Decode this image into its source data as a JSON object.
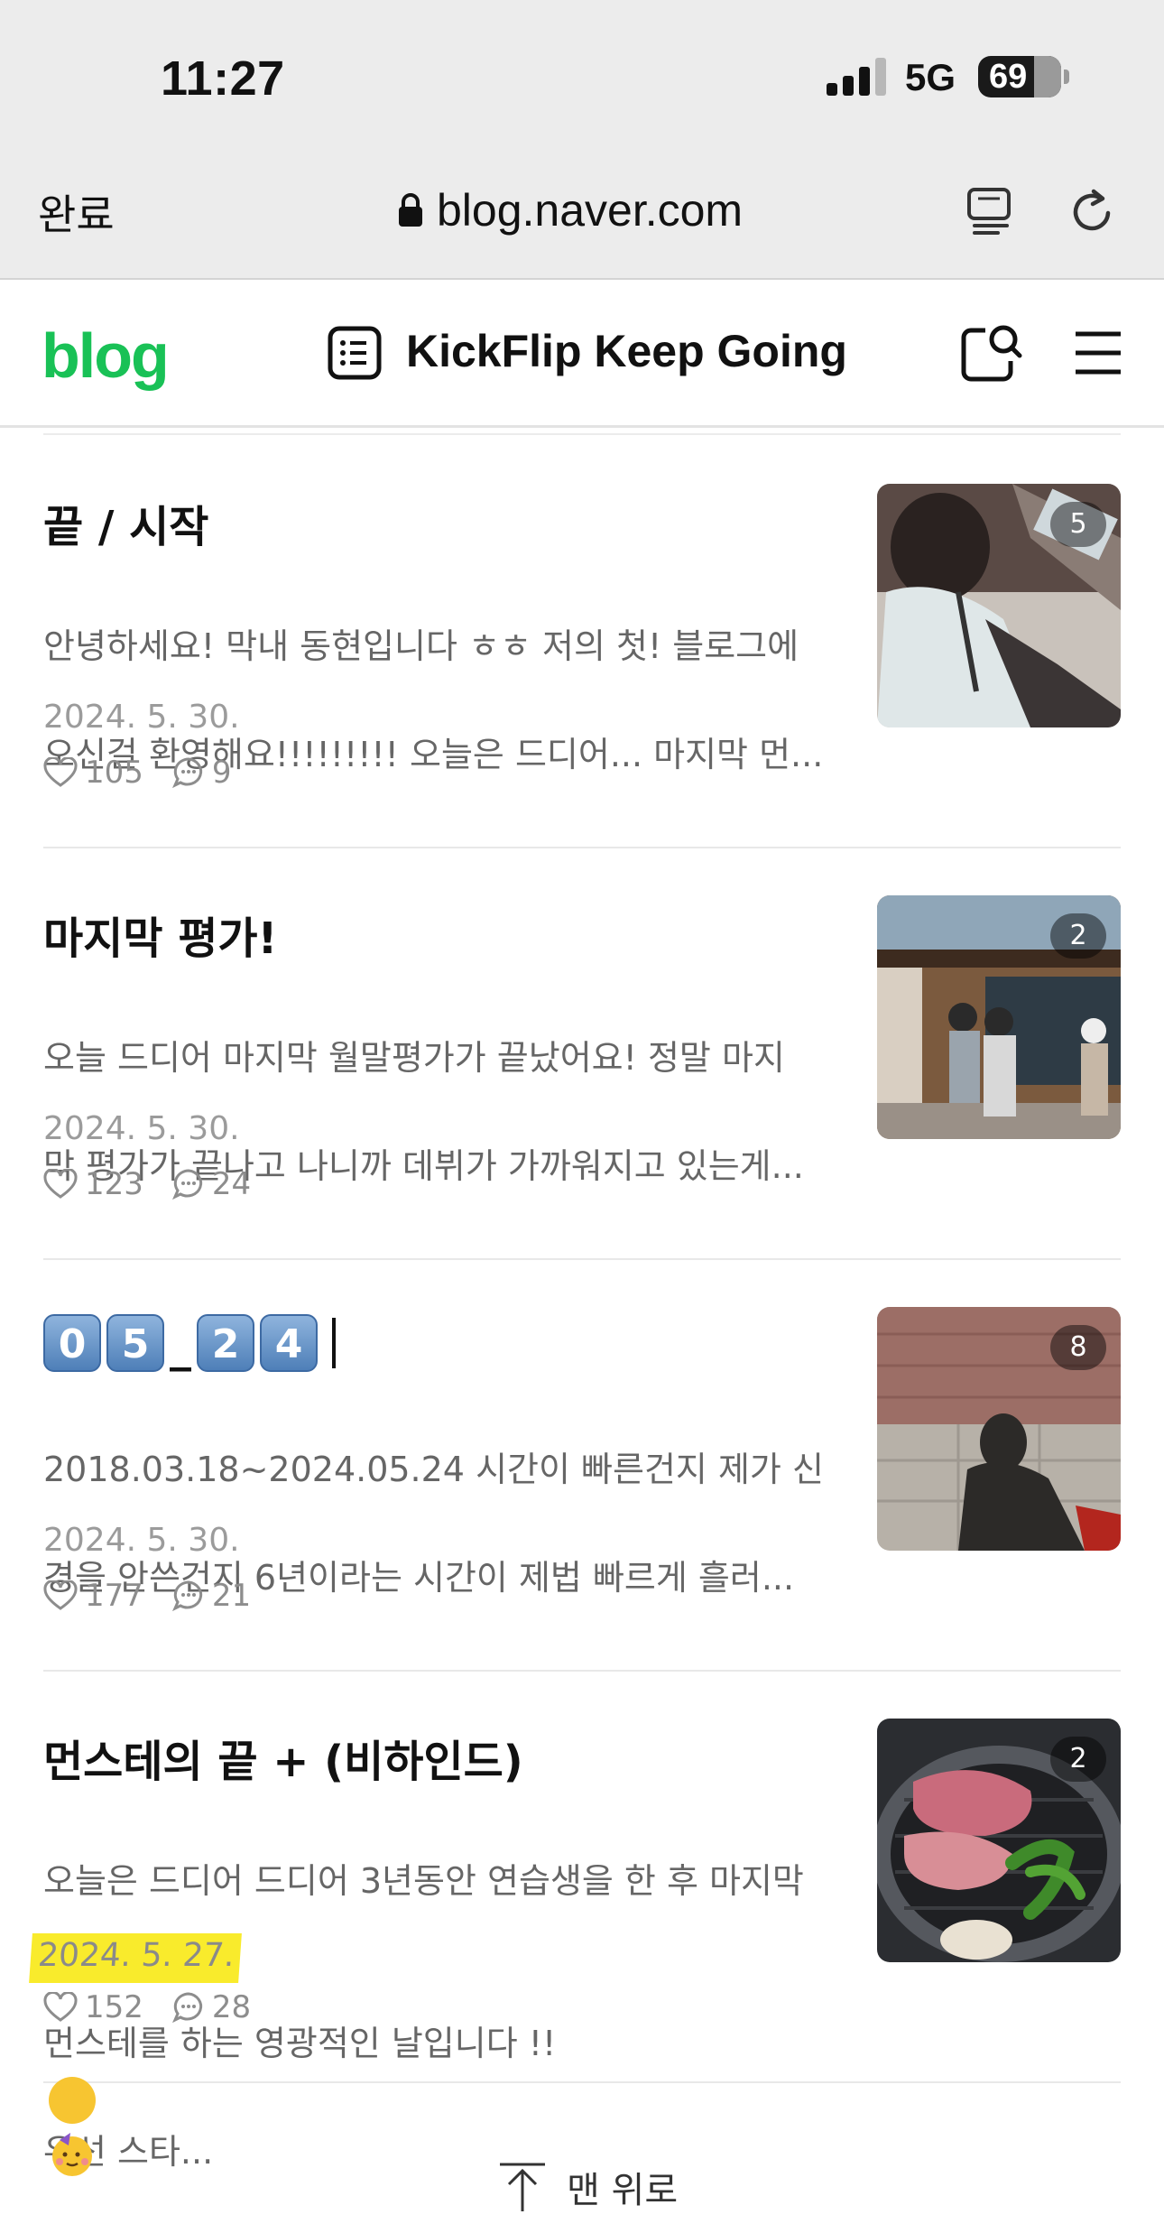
{
  "status_bar": {
    "time": "11:27",
    "network": "5G",
    "battery": "69"
  },
  "browser": {
    "done_label": "완료",
    "url": "blog.naver.com",
    "icons": [
      "lock-icon",
      "reader-icon",
      "reload-icon"
    ]
  },
  "blog_header": {
    "logo": "blog",
    "title": "KickFlip Keep Going",
    "logo_color": "#19c156"
  },
  "posts": [
    {
      "title": "끝 / 시작",
      "excerpt_line1": "안녕하세요! 막내 동현입니다 ㅎㅎ 저의 첫! 블로그에",
      "excerpt_line2": "오신걸 환영해요!!!!!!!!! 오늘은 드디어... 마지막 먼...",
      "date": "2024. 5. 30.",
      "likes": "105",
      "comments": "9",
      "photo_count": "5"
    },
    {
      "title": "마지막 평가!",
      "excerpt_line1": "오늘 드디어 마지막 월말평가가 끝났어요! 정말 마지",
      "excerpt_line2": "막 평가가 끝나고 나니까 데뷔가 가까워지고 있는게...",
      "date": "2024. 5. 30.",
      "likes": "123",
      "comments": "24",
      "photo_count": "2"
    },
    {
      "title_digits": [
        "0",
        "5",
        "2",
        "4"
      ],
      "title_separator": "_",
      "excerpt_line1": "2018.03.18~2024.05.24 시간이 빠른건지 제가 신",
      "excerpt_line2": "경을 안쓴건지 6년이라는 시간이 제법 빠르게 흘러...",
      "date": "2024. 5. 30.",
      "likes": "177",
      "comments": "21",
      "photo_count": "8"
    },
    {
      "title": "먼스테의 끝 + (비하인드)",
      "excerpt_line1": "오늘은 드디어 드디어 3년동안 연습생을 한 후 마지막",
      "excerpt_line2a": "먼스테를 하는 영광적인 날입니다 !!",
      "excerpt_line2b": "우선 스타...",
      "date": "2024. 5. 27.",
      "likes": "152",
      "comments": "28",
      "photo_count": "2",
      "date_highlight_color": "#f9eb2c"
    }
  ],
  "footer": {
    "back_to_top": "맨 위로"
  }
}
